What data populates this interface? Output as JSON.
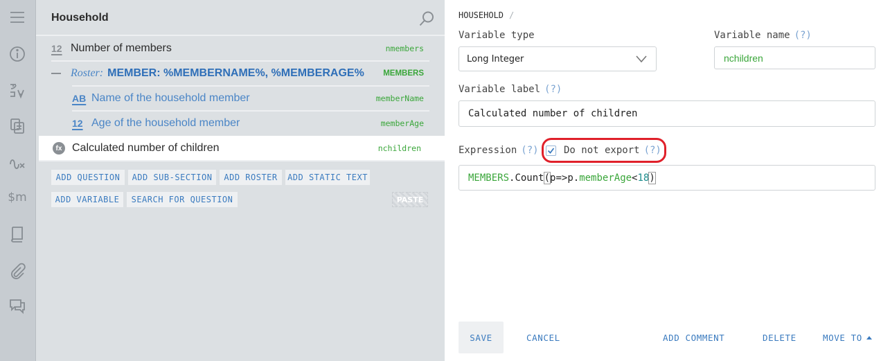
{
  "rail": {
    "icons": [
      "menu-icon",
      "info-icon",
      "translation-icon",
      "copy-icon",
      "macros-icon",
      "lookup-tables-icon",
      "book-icon",
      "attachment-icon",
      "comments-icon"
    ],
    "lookup_text": "$m"
  },
  "tree": {
    "title": "Household",
    "items": [
      {
        "type_badge": "12",
        "label": "Number of members",
        "variable": "nmembers"
      },
      {
        "roster_prefix": "Roster:",
        "label": "MEMBER: %MEMBERNAME%, %MEMBERAGE%",
        "variable": "MEMBERS"
      },
      {
        "type_badge": "AB",
        "label": "Name of the household member",
        "variable": "memberName"
      },
      {
        "type_badge": "12",
        "label": "Age of the household member",
        "variable": "memberAge"
      },
      {
        "type_badge": "fx",
        "label": "Calculated number of children",
        "variable": "nchildren"
      }
    ],
    "buttons": {
      "add_question": "ADD QUESTION",
      "add_sub_section": "ADD SUB-SECTION",
      "add_roster": "ADD ROSTER",
      "add_static_text": "ADD STATIC TEXT",
      "add_variable": "ADD VARIABLE",
      "search_for_question": "SEARCH FOR QUESTION",
      "paste": "PASTE"
    }
  },
  "editor": {
    "breadcrumb": "HOUSEHOLD",
    "breadcrumb_sep": "/",
    "variable_type_label": "Variable type",
    "variable_type_value": "Long Integer",
    "variable_name_label": "Variable name",
    "variable_name_value": "nchildren",
    "variable_label_label": "Variable label",
    "variable_label_value": "Calculated number of children",
    "expression_label": "Expression",
    "help_mark": "(?)",
    "do_not_export_label": "Do not export",
    "do_not_export_checked": true,
    "expression": {
      "t1": "MEMBERS",
      "t2": ".Count",
      "t3": "(",
      "t4": "p=>p.",
      "t5": "memberAge",
      "t6": "<",
      "t7": "18",
      "t8": ")"
    },
    "footer": {
      "save": "SAVE",
      "cancel": "CANCEL",
      "add_comment": "ADD COMMENT",
      "delete": "DELETE",
      "move_to": "MOVE TO"
    },
    "colors": {
      "accent": "#3b7bbf",
      "variable_green": "#3aa63a",
      "highlight_red": "#e0202a"
    }
  }
}
